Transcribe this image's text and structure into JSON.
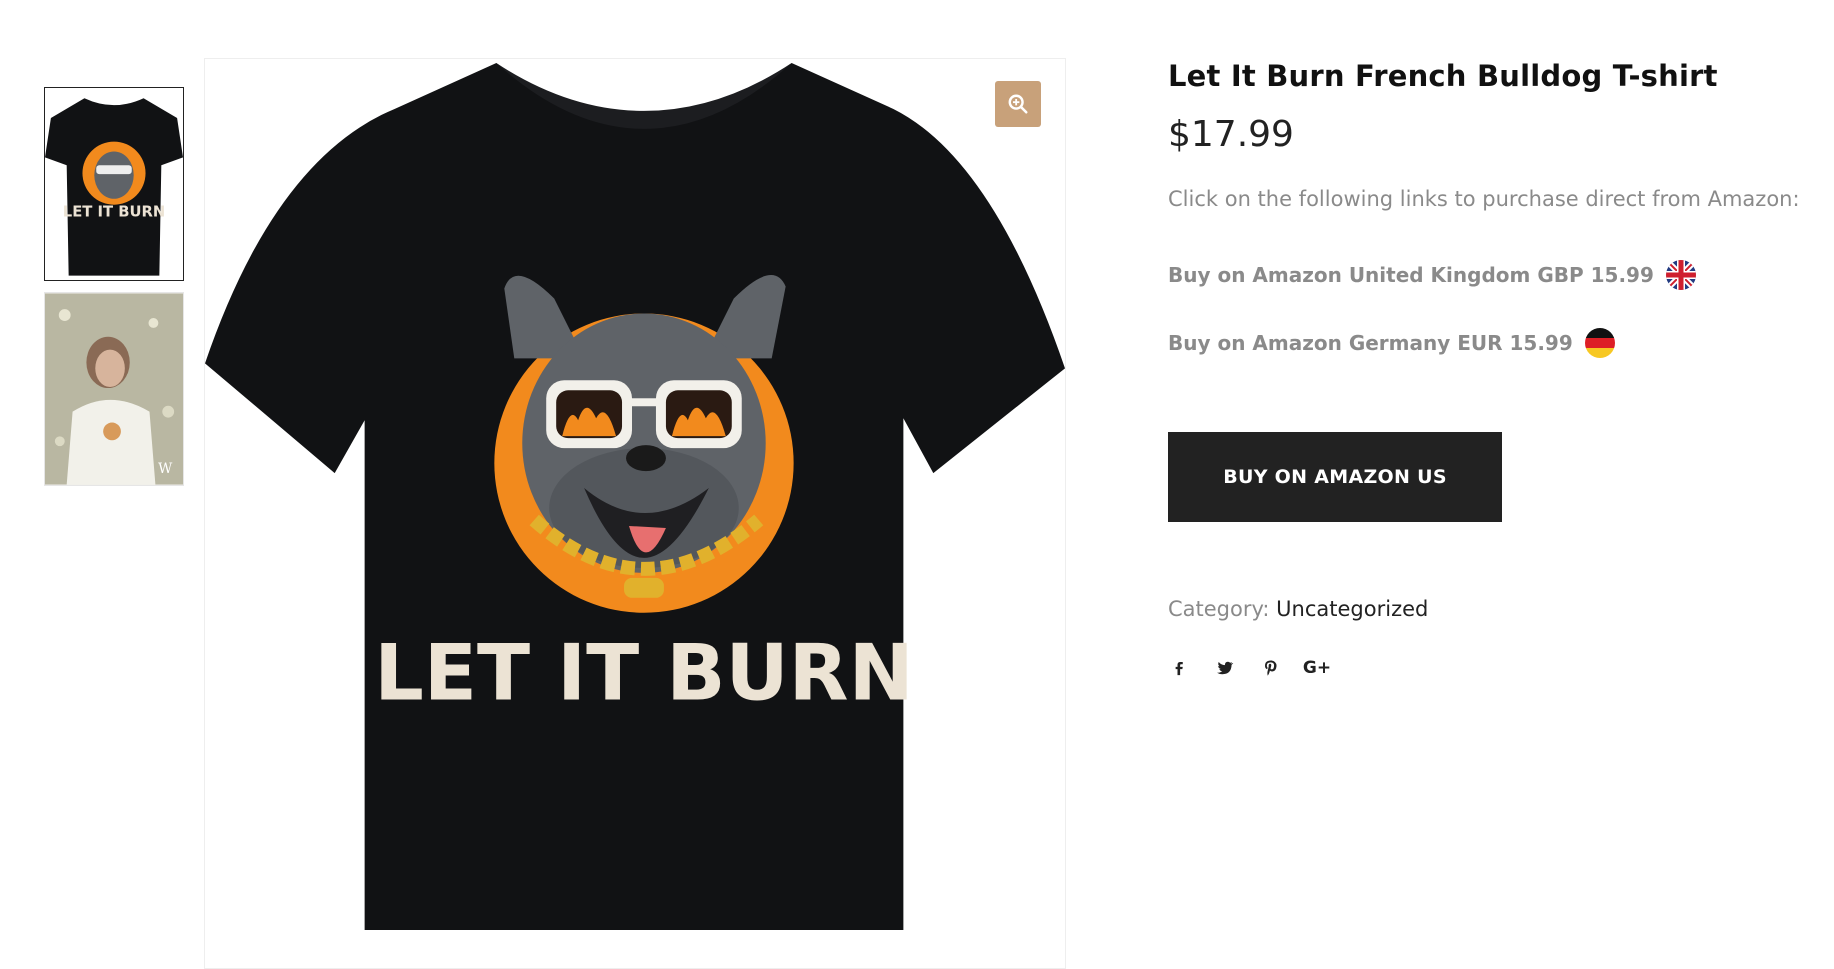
{
  "gallery": {
    "thumbnails": [
      {
        "name": "black t-shirt with bulldog print",
        "active": true
      },
      {
        "name": "model wearing white t-shirt with watermark",
        "active": false,
        "watermark": "W"
      }
    ],
    "main_print_text": "LET IT BURN",
    "zoom_icon": "zoom-in-icon"
  },
  "product": {
    "title": "Let It Burn French Bulldog T-shirt",
    "price": "$17.99",
    "intro": "Click on the following links to purchase direct from Amazon:",
    "links": [
      {
        "label": "Buy on Amazon United Kingdom GBP 15.99",
        "flag": "uk-flag-icon"
      },
      {
        "label": "Buy on Amazon Germany EUR 15.99",
        "flag": "germany-flag-icon"
      }
    ],
    "button_label": "BUY ON AMAZON US",
    "category_label": "Category:",
    "category_value": "Uncategorized",
    "share": {
      "googleplus_label": "G+",
      "icons": [
        "facebook-icon",
        "twitter-icon",
        "pinterest-icon",
        "google-plus-icon"
      ]
    }
  },
  "colors": {
    "accent": "#c8a17a",
    "button_bg": "#222222",
    "muted_text": "#8a8a8a",
    "shirt": "#111214",
    "print_circle": "#f28a1d"
  }
}
